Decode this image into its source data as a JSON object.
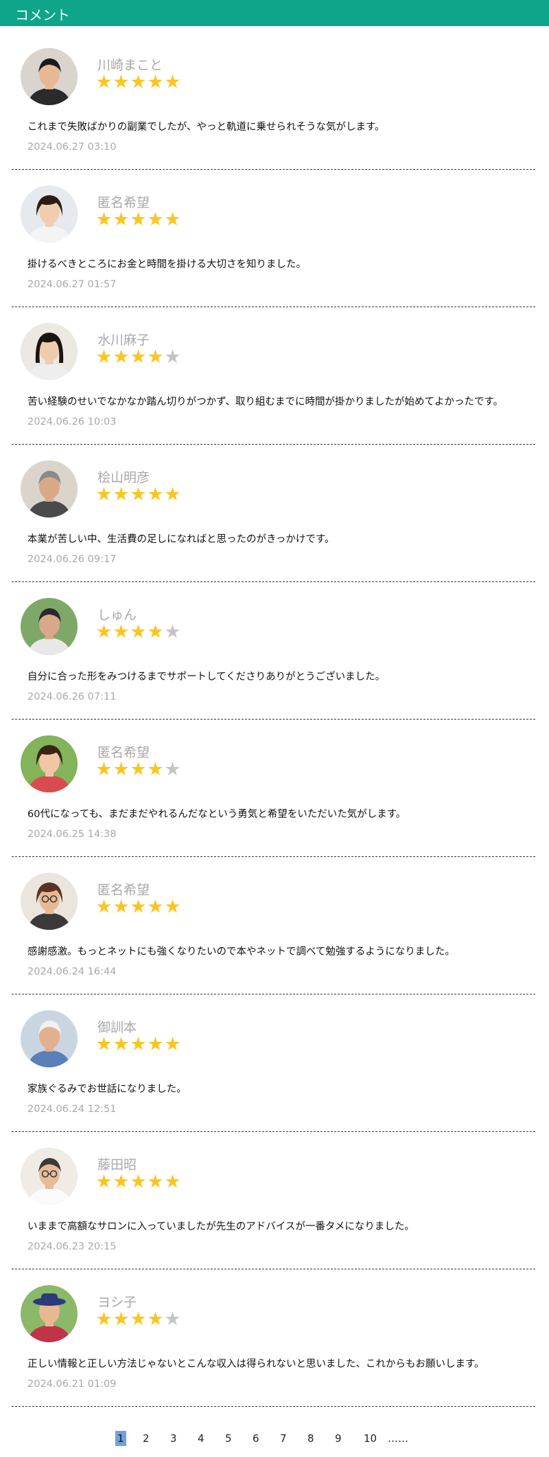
{
  "header": {
    "title": "コメント"
  },
  "comments": [
    {
      "name": "川崎まこと",
      "rating": 5,
      "text": "これまで失敗ばかりの副業でしたが、やっと軌道に乗せられそうな気がします。",
      "date": "2024.06.27 03:10",
      "avatar": "young-man-black-shirt"
    },
    {
      "name": "匿名希望",
      "rating": 5,
      "text": "掛けるべきところにお金と時間を掛ける大切さを知りました。",
      "date": "2024.06.27 01:57",
      "avatar": "smiling-woman"
    },
    {
      "name": "水川麻子",
      "rating": 4,
      "text": "苦い経験のせいでなかなか踏ん切りがつかず、取り組むまでに時間が掛かりましたが始めてよかったです。",
      "date": "2024.06.26 10:03",
      "avatar": "woman-dark-hair"
    },
    {
      "name": "桧山明彦",
      "rating": 5,
      "text": "本業が苦しい中、生活費の足しになればと思ったのがきっかけです。",
      "date": "2024.06.26 09:17",
      "avatar": "man-gray-hair-profile"
    },
    {
      "name": "しゅん",
      "rating": 4,
      "text": "自分に合った形をみつけるまでサポートしてくださりありがとうございました。",
      "date": "2024.06.26 07:11",
      "avatar": "man-outdoors"
    },
    {
      "name": "匿名希望",
      "rating": 4,
      "text": "60代になっても、まだまだやれるんだなという勇気と希望をいただいた気がします。",
      "date": "2024.06.25 14:38",
      "avatar": "woman-striped-shirt"
    },
    {
      "name": "匿名希望",
      "rating": 5,
      "text": "感謝感激。もっとネットにも強くなりたいので本やネットで調べて勉強するようになりました。",
      "date": "2024.06.24 16:44",
      "avatar": "woman-glasses"
    },
    {
      "name": "御訓本",
      "rating": 5,
      "text": "家族ぐるみでお世話になりました。",
      "date": "2024.06.24 12:51",
      "avatar": "old-man-white-hair"
    },
    {
      "name": "藤田昭",
      "rating": 5,
      "text": "いままで高額なサロンに入っていましたが先生のアドバイスが一番タメになりました。",
      "date": "2024.06.23 20:15",
      "avatar": "man-white-shirt"
    },
    {
      "name": "ヨシ子",
      "rating": 4,
      "text": "正しい情報と正しい方法じゃないとこんな収入は得られないと思いました、これからもお願いします。",
      "date": "2024.06.21 01:09",
      "avatar": "woman-hat-field"
    }
  ],
  "pagination": {
    "pages": [
      "1",
      "2",
      "3",
      "4",
      "5",
      "6",
      "7",
      "8",
      "9",
      "10"
    ],
    "current": "1",
    "more": "……"
  },
  "colors": {
    "header": "#0ea58a",
    "star_full": "#fbc521",
    "star_empty": "#c4c4c4",
    "current_page": "#6fa3d8"
  }
}
